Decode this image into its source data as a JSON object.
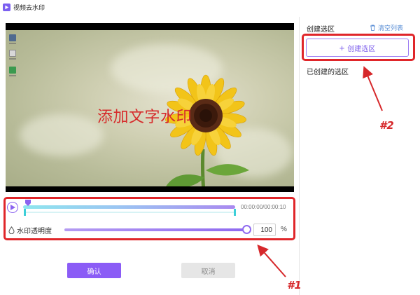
{
  "window": {
    "title": "视频去水印"
  },
  "video": {
    "watermark_text": "添加文字水印"
  },
  "timeline": {
    "time_display": "00:00:00/00:00:10"
  },
  "opacity": {
    "label": "水印透明度",
    "value": "100",
    "unit": "%",
    "level": 1.0
  },
  "buttons": {
    "confirm": "确认",
    "cancel": "取消"
  },
  "right_panel": {
    "create_section_title": "创建选区",
    "clear_list": "清空列表",
    "create_button": "创建选区",
    "created_title": "已创建的选区"
  },
  "annotations": {
    "label_1": "#1",
    "label_2": "#2"
  },
  "colors": {
    "accent": "#8b5cf6",
    "annotation": "#e0262a"
  }
}
